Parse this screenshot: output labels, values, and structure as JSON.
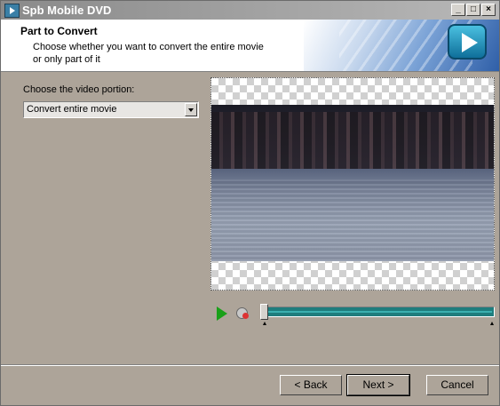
{
  "window": {
    "title": "Spb Mobile DVD"
  },
  "titlebar_buttons": {
    "minimize": "_",
    "maximize": "□",
    "close": "×"
  },
  "header": {
    "title": "Part to Convert",
    "subtitle": "Choose whether you want to convert the entire movie or only part of it",
    "icon": "play-icon"
  },
  "portion": {
    "label": "Choose the video portion:",
    "selected": "Convert entire movie"
  },
  "player": {
    "play_icon": "play-icon",
    "clip_icon": "clip-mark-icon",
    "progress": 0.0
  },
  "buttons": {
    "back": "< Back",
    "next": "Next >",
    "cancel": "Cancel"
  },
  "colors": {
    "slider": "#1f7d7d",
    "play": "#19a019",
    "background": "#ada499"
  }
}
